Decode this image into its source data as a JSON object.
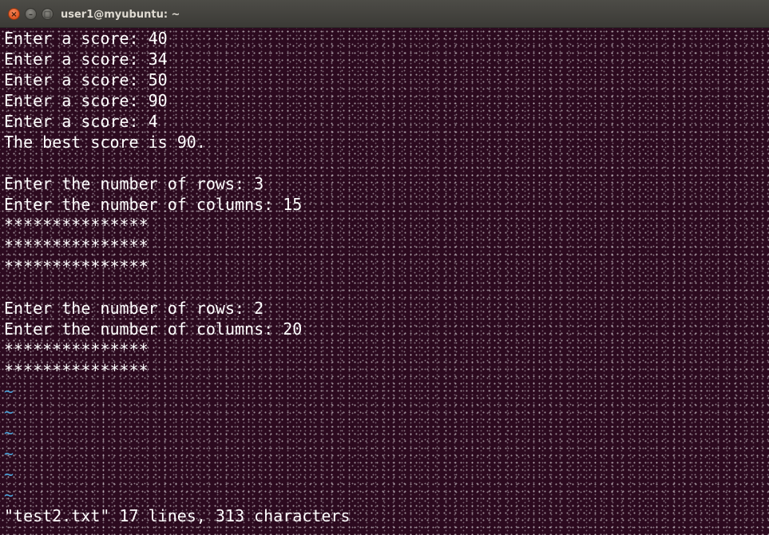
{
  "window": {
    "title": "user1@myubuntu: ~",
    "close_glyph": "×",
    "minimize_glyph": "–",
    "maximize_glyph": "□"
  },
  "terminal": {
    "lines": [
      "Enter a score: 40",
      "Enter a score: 34",
      "Enter a score: 50",
      "Enter a score: 90",
      "Enter a score: 4",
      "The best score is 90.",
      "",
      "Enter the number of rows: 3",
      "Enter the number of columns: 15",
      "***************",
      "***************",
      "***************",
      "",
      "Enter the number of rows: 2",
      "Enter the number of columns: 20",
      "***************",
      "***************"
    ],
    "tildes": [
      "~",
      "~",
      "~",
      "~",
      "~",
      "~"
    ],
    "status": "\"test2.txt\" 17 lines, 313 characters"
  },
  "colors": {
    "background": "#2c0a1f",
    "text": "#ffffff",
    "tilde": "#4aa3d8",
    "titlebar": "#3c3b37",
    "close_button": "#e0531f"
  }
}
